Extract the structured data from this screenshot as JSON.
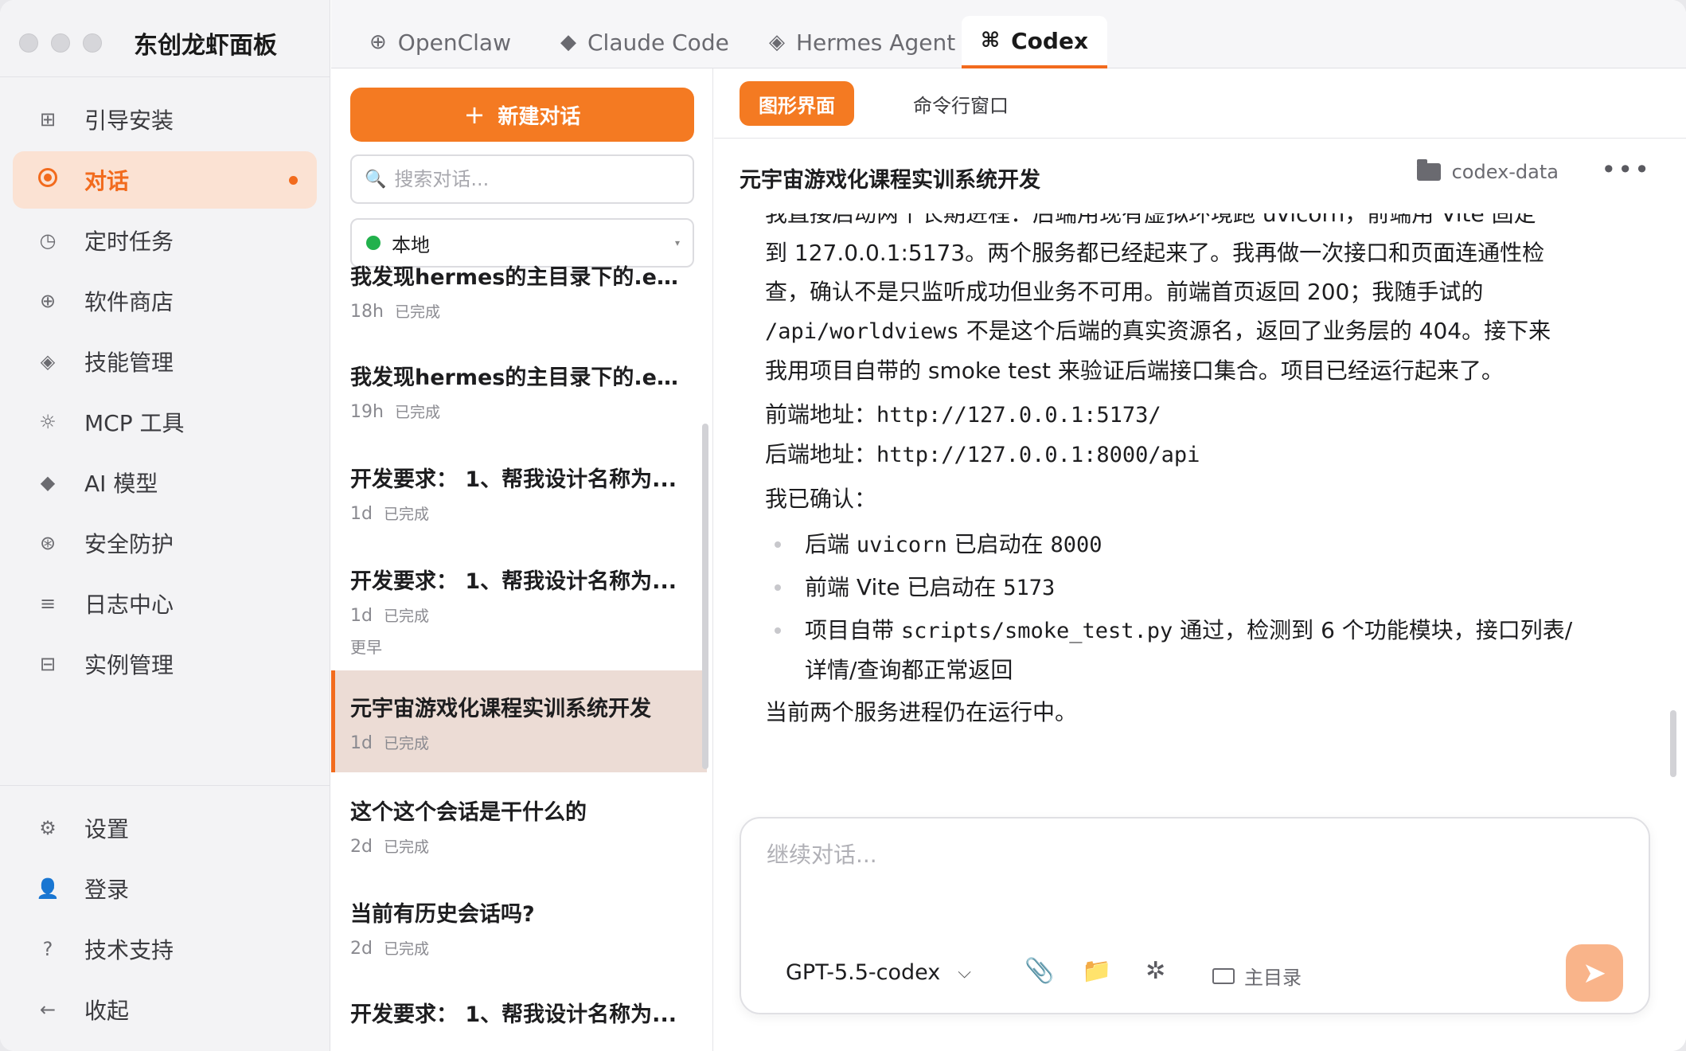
{
  "app": {
    "title": "东创龙虾面板"
  },
  "sidebar": {
    "items": [
      {
        "label": "引导安装",
        "icon": "grid-icon"
      },
      {
        "label": "对话",
        "icon": "chat-target-icon",
        "active": true
      },
      {
        "label": "定时任务",
        "icon": "clock-icon"
      },
      {
        "label": "软件商店",
        "icon": "plus-circle-icon"
      },
      {
        "label": "技能管理",
        "icon": "diamond-outline-icon"
      },
      {
        "label": "MCP 工具",
        "icon": "gear-small-icon"
      },
      {
        "label": "AI 模型",
        "icon": "diamond-solid-icon"
      },
      {
        "label": "安全防护",
        "icon": "shield-circle-icon"
      },
      {
        "label": "日志中心",
        "icon": "list-icon"
      },
      {
        "label": "实例管理",
        "icon": "instance-icon"
      }
    ],
    "bottom_items": [
      {
        "label": "设置",
        "icon": "gear-icon"
      },
      {
        "label": "登录",
        "icon": "user-icon"
      },
      {
        "label": "技术支持",
        "icon": "question-icon"
      },
      {
        "label": "收起",
        "icon": "arrow-left-icon"
      }
    ]
  },
  "tabs": [
    {
      "label": "OpenClaw",
      "icon": "plus-circle-icon"
    },
    {
      "label": "Claude Code",
      "icon": "diamond-solid-icon"
    },
    {
      "label": "Hermes Agent",
      "icon": "diamond-outline-icon"
    },
    {
      "label": "Codex",
      "icon": "command-icon",
      "active": true
    }
  ],
  "conversations": {
    "new_chat_label": "新建对话",
    "search_placeholder": "搜索对话...",
    "env_selected": "本地",
    "section_earlier": "更早",
    "items": [
      {
        "title": "我发现hermes的主目录下的.en...",
        "age": "18h",
        "status": "已完成"
      },
      {
        "title": "我发现hermes的主目录下的.en...",
        "age": "19h",
        "status": "已完成"
      },
      {
        "title": "开发要求： 1、帮我设计名称为...",
        "age": "1d",
        "status": "已完成"
      },
      {
        "title": "开发要求： 1、帮我设计名称为...",
        "age": "1d",
        "status": "已完成"
      }
    ],
    "earlier_items": [
      {
        "title": "元宇宙游戏化课程实训系统开发",
        "age": "1d",
        "status": "已完成",
        "selected": true
      },
      {
        "title": "这个这个会话是干什么的",
        "age": "2d",
        "status": "已完成"
      },
      {
        "title": "当前有历史会话吗?",
        "age": "2d",
        "status": "已完成"
      },
      {
        "title": "开发要求： 1、帮我设计名称为...",
        "age": "",
        "status": ""
      }
    ]
  },
  "chat": {
    "mode_gui": "图形界面",
    "mode_cli": "命令行窗口",
    "title": "元宇宙游戏化课程实训系统开发",
    "folder": "codex-data",
    "more": "•••",
    "message": {
      "line0": "我直接启动两个长期进程：后端用现有虚拟环境跑 uvicorn，前端用 Vite 固定",
      "line1": "到 127.0.0.1:5173。两个服务都已经起来了。我再做一次接口和页面连通性检",
      "line2": "查，确认不是只监听成功但业务不可用。前端首页返回 200；我随手试的",
      "line3_code": "/api/worldviews",
      "line3_rest": " 不是这个后端的真实资源名，返回了业务层的 404。接下来",
      "line4": "我用项目自带的 smoke test 来验证后端接口集合。项目已经运行起来了。",
      "frontend_label": "前端地址：",
      "frontend_url": "http://127.0.0.1:5173/",
      "backend_label": "后端地址：",
      "backend_url": "http://127.0.0.1:8000/api",
      "confirmed": "我已确认：",
      "b1_a": "后端 ",
      "b1_code": "uvicorn",
      "b1_b": " 已启动在 ",
      "b1_code2": "8000",
      "b2_a": "前端 Vite 已启动在 ",
      "b2_code": "5173",
      "b3_a": "项目自带 ",
      "b3_code": "scripts/smoke_test.py",
      "b3_b": " 通过，检测到 6 个功能模块，接口列表/",
      "b3_c": "详情/查询都正常返回",
      "footer": "当前两个服务进程仍在运行中。"
    }
  },
  "composer": {
    "placeholder": "继续对话...",
    "model": "GPT-5.5-codex",
    "dir_label": "主目录"
  },
  "colors": {
    "accent": "#f47a22",
    "active_bg": "#fbe2d3",
    "selected_row": "#ecdcd5",
    "online": "#22b14c"
  }
}
